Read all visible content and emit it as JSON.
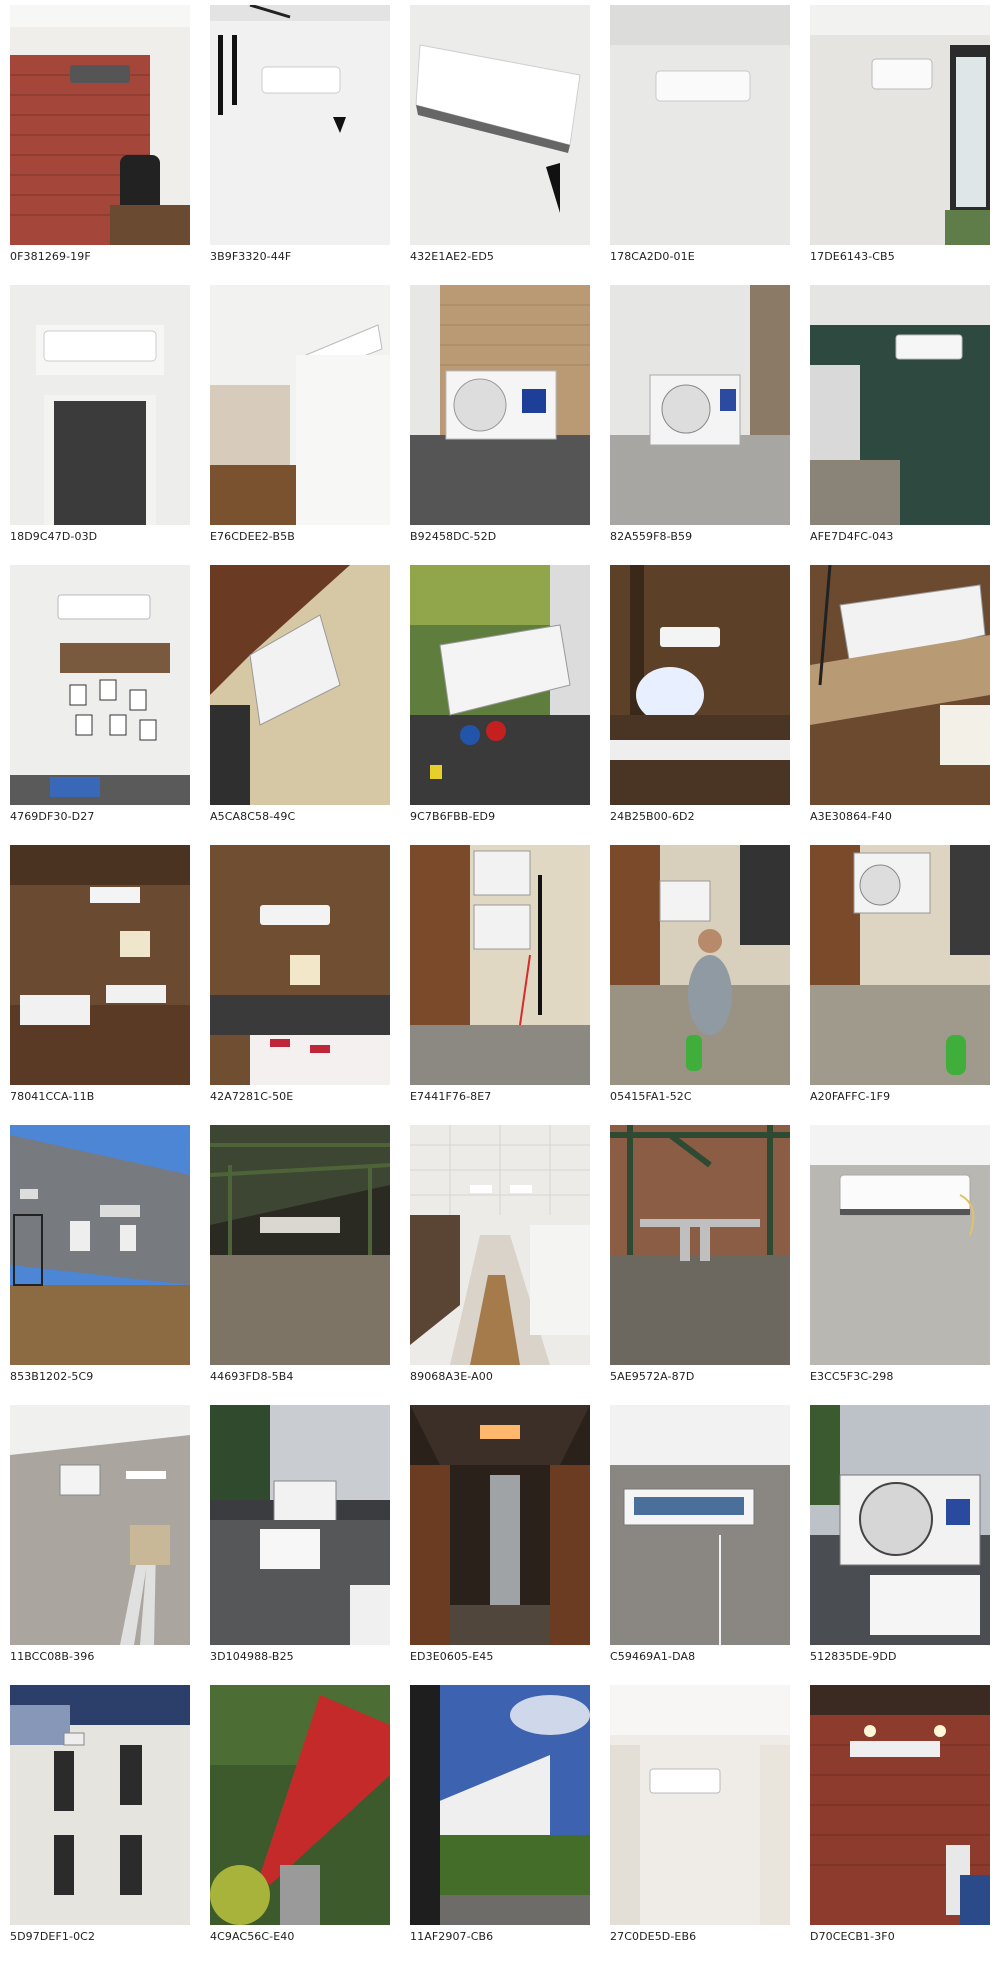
{
  "gallery": {
    "tiles": [
      {
        "caption": "0F381269-19F",
        "scene": "brick-wall-indoor-unit"
      },
      {
        "caption": "3B9F3320-44F",
        "scene": "white-wall-indoor-unit"
      },
      {
        "caption": "432E1AE2-ED5",
        "scene": "indoor-unit-closeup"
      },
      {
        "caption": "178CA2D0-01E",
        "scene": "white-wall-indoor-unit"
      },
      {
        "caption": "17DE6143-CB5",
        "scene": "window-corner-indoor-unit"
      },
      {
        "caption": "18D9C47D-03D",
        "scene": "doorway-indoor-unit"
      },
      {
        "caption": "E76CDEE2-B5B",
        "scene": "ceiling-indoor-unit"
      },
      {
        "caption": "B92458DC-52D",
        "scene": "balcony-outdoor-unit"
      },
      {
        "caption": "82A559F8-B59",
        "scene": "balcony-outdoor-unit"
      },
      {
        "caption": "AFE7D4FC-043",
        "scene": "green-wall-indoor-unit"
      },
      {
        "caption": "4769DF30-D27",
        "scene": "gallery-wall-indoor-unit"
      },
      {
        "caption": "A5CA8C58-49C",
        "scene": "outdoor-unit-bracket"
      },
      {
        "caption": "9C7B6FBB-ED9",
        "scene": "outdoor-unit-gauges"
      },
      {
        "caption": "24B25B00-6D2",
        "scene": "wood-ceiling-indoor-unit"
      },
      {
        "caption": "A3E30864-F40",
        "scene": "wood-ceiling-indoor-unit"
      },
      {
        "caption": "78041CCA-11B",
        "scene": "restaurant-hall"
      },
      {
        "caption": "42A7281C-50E",
        "scene": "restaurant-hall"
      },
      {
        "caption": "E7441F76-8E7",
        "scene": "wall-outdoor-units"
      },
      {
        "caption": "05415FA1-52C",
        "scene": "installer-outdoor-unit"
      },
      {
        "caption": "A20FAFFC-1F9",
        "scene": "wall-outdoor-unit"
      },
      {
        "caption": "853B1202-5C9",
        "scene": "building-facade"
      },
      {
        "caption": "44693FD8-5B4",
        "scene": "construction-roof"
      },
      {
        "caption": "89068A3E-A00",
        "scene": "corridor"
      },
      {
        "caption": "5AE9572A-87D",
        "scene": "pipework"
      },
      {
        "caption": "E3CC5F3C-298",
        "scene": "concrete-indoor-unit"
      },
      {
        "caption": "11BCC08B-396",
        "scene": "room-ladder"
      },
      {
        "caption": "3D104988-B25",
        "scene": "roof-outdoor-unit"
      },
      {
        "caption": "ED3E0605-E45",
        "scene": "ducting"
      },
      {
        "caption": "C59469A1-DA8",
        "scene": "open-indoor-unit"
      },
      {
        "caption": "512835DE-9DD",
        "scene": "outdoor-unit-sky"
      },
      {
        "caption": "5D97DEF1-0C2",
        "scene": "white-facade"
      },
      {
        "caption": "4C9AC56C-E40",
        "scene": "crane-truck"
      },
      {
        "caption": "11AF2907-CB6",
        "scene": "apartment-block"
      },
      {
        "caption": "27C0DE5D-EB6",
        "scene": "white-wall-indoor-unit"
      },
      {
        "caption": "D70CECB1-3F0",
        "scene": "brick-wall-lights"
      }
    ]
  }
}
